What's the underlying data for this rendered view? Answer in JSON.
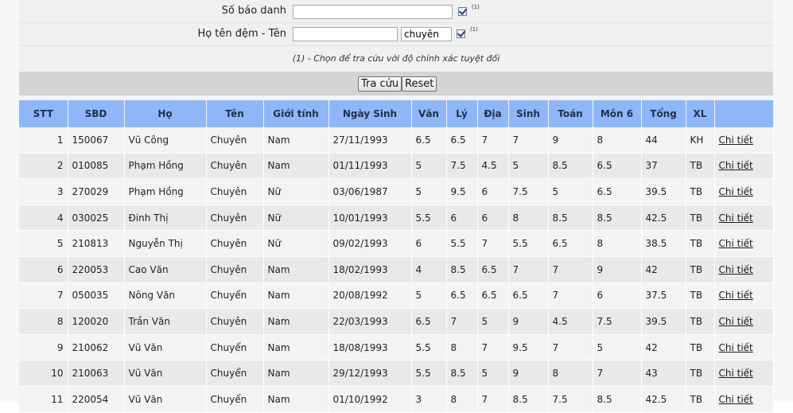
{
  "form": {
    "sbd_label": "Số báo danh",
    "sbd_value": "",
    "name_label": "Họ tên đệm - Tên",
    "name_value": "",
    "name_suffix_value": "chuyên",
    "footnote_marker": "(1)",
    "note": "(1) - Chọn để tra cứu với độ chính xác tuyệt đối",
    "search_label": "Tra cứu",
    "reset_label": "Reset"
  },
  "table": {
    "headers": [
      "STT",
      "SBD",
      "Họ",
      "Tên",
      "Giới tính",
      "Ngày Sinh",
      "Văn",
      "Lý",
      "Địa",
      "Sinh",
      "Toán",
      "Môn 6",
      "Tổng",
      "XL",
      ""
    ],
    "detail_link": "Chi tiết",
    "rows": [
      [
        "1",
        "150067",
        "Vũ Công",
        "Chuyên",
        "Nam",
        "27/11/1993",
        "6.5",
        "6.5",
        "7",
        "7",
        "9",
        "8",
        "44",
        "KH"
      ],
      [
        "2",
        "010085",
        "Phạm Hồng",
        "Chuyên",
        "Nam",
        "01/11/1993",
        "5",
        "7.5",
        "4.5",
        "5",
        "8.5",
        "6.5",
        "37",
        "TB"
      ],
      [
        "3",
        "270029",
        "Phạm Hồng",
        "Chuyên",
        "Nữ",
        "03/06/1987",
        "5",
        "9.5",
        "6",
        "7.5",
        "5",
        "6.5",
        "39.5",
        "TB"
      ],
      [
        "4",
        "030025",
        "Đinh Thị",
        "Chuyên",
        "Nữ",
        "10/01/1993",
        "5.5",
        "6",
        "6",
        "8",
        "8.5",
        "8.5",
        "42.5",
        "TB"
      ],
      [
        "5",
        "210813",
        "Nguyễn Thị",
        "Chuyên",
        "Nữ",
        "09/02/1993",
        "6",
        "5.5",
        "7",
        "5.5",
        "6.5",
        "8",
        "38.5",
        "TB"
      ],
      [
        "6",
        "220053",
        "Cao Văn",
        "Chuyên",
        "Nam",
        "18/02/1993",
        "4",
        "8.5",
        "6.5",
        "7",
        "7",
        "9",
        "42",
        "TB"
      ],
      [
        "7",
        "050035",
        "Nông Văn",
        "Chuyển",
        "Nam",
        "20/08/1992",
        "5",
        "6.5",
        "6.5",
        "6.5",
        "7",
        "6",
        "37.5",
        "TB"
      ],
      [
        "8",
        "120020",
        "Trần Văn",
        "Chuyên",
        "Nam",
        "22/03/1993",
        "6.5",
        "7",
        "5",
        "9",
        "4.5",
        "7.5",
        "39.5",
        "TB"
      ],
      [
        "9",
        "210062",
        "Vũ Văn",
        "Chuyển",
        "Nam",
        "18/08/1993",
        "5.5",
        "8",
        "7",
        "9.5",
        "7",
        "5",
        "42",
        "TB"
      ],
      [
        "10",
        "210063",
        "Vũ Văn",
        "Chuyển",
        "Nam",
        "29/12/1993",
        "5.5",
        "8.5",
        "5",
        "9",
        "8",
        "7",
        "43",
        "TB"
      ],
      [
        "11",
        "220054",
        "Vũ Văn",
        "Chuyển",
        "Nam",
        "01/10/1992",
        "3",
        "8",
        "7",
        "8.5",
        "7.5",
        "8.5",
        "42.5",
        "TB"
      ]
    ]
  }
}
